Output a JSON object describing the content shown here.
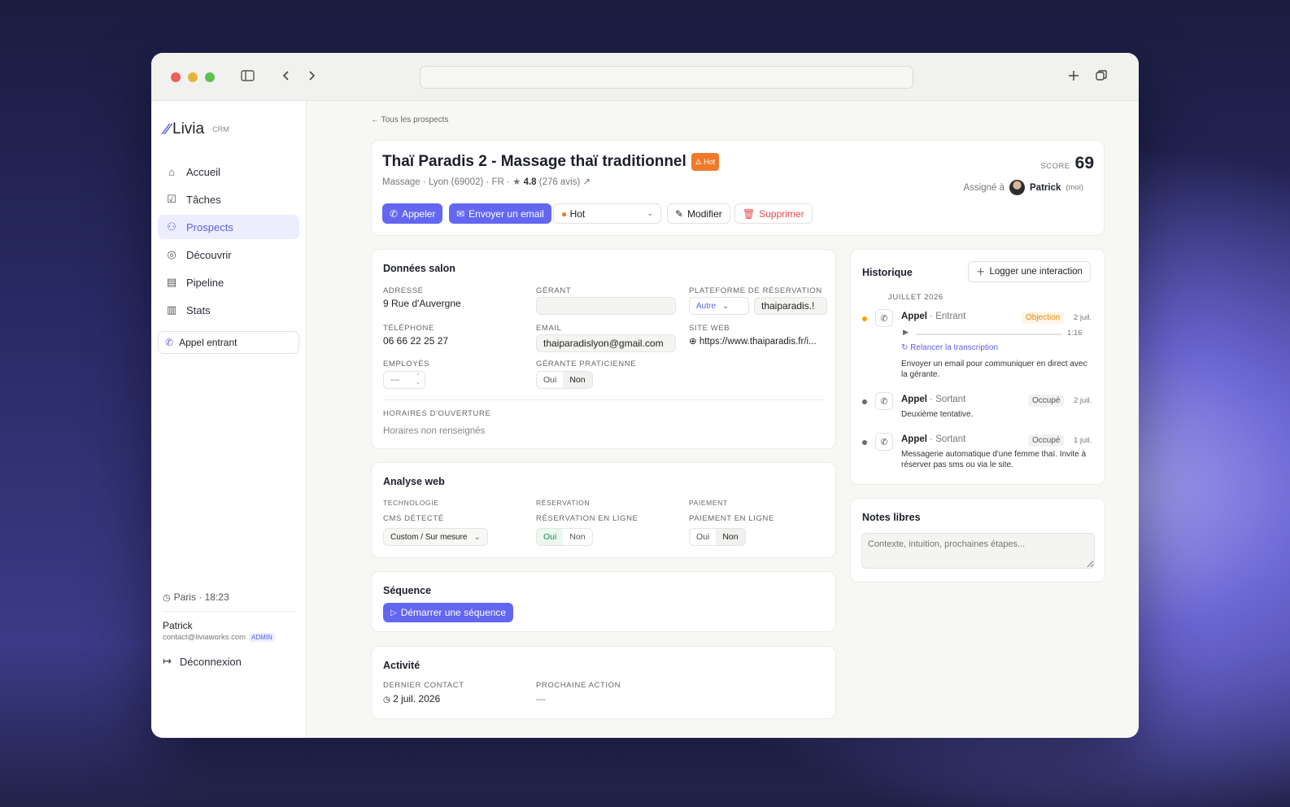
{
  "browser": {
    "url": ""
  },
  "sidebar": {
    "logo": "Livia",
    "logo_tag": "CRM",
    "items": [
      {
        "label": "Accueil",
        "icon": "home-icon"
      },
      {
        "label": "Tâches",
        "icon": "checkbox-icon"
      },
      {
        "label": "Prospects",
        "icon": "users-icon"
      },
      {
        "label": "Découvrir",
        "icon": "compass-icon"
      },
      {
        "label": "Pipeline",
        "icon": "kanban-icon"
      },
      {
        "label": "Stats",
        "icon": "bar-chart-icon"
      }
    ],
    "incoming_call": "Appel entrant",
    "clock": "Paris · 18:23",
    "user_name": "Patrick",
    "user_email": "contact@liviaworks.com",
    "user_role": "ADMIN",
    "logout": "Déconnexion"
  },
  "breadcrumb": "Tous les prospects",
  "prospect": {
    "title": "Thaï Paradis 2 - Massage thaï traditionnel",
    "status_badge": "Hot",
    "category": "Massage",
    "city": "Lyon (69002)",
    "country": "FR",
    "rating": "4.8",
    "reviews": "(276 avis)",
    "score_label": "SCORE",
    "score": "69",
    "assigned_label": "Assigné à",
    "assignee": "Patrick",
    "assignee_note": "(moi)"
  },
  "actions": {
    "call": "Appeler",
    "email": "Envoyer un email",
    "status": "Hot",
    "edit": "Modifier",
    "delete": "Supprimer"
  },
  "salon": {
    "title": "Données salon",
    "address_label": "ADRESSE",
    "address": "9 Rue d'Auvergne",
    "manager_label": "GÉRANT",
    "manager": "",
    "platform_label": "PLATEFORME DE RÉSERVATION",
    "platform_select": "Autre",
    "platform_value": "thaiparadis.!",
    "phone_label": "TÉLÉPHONE",
    "phone": "06 66 22 25 27",
    "email_label": "EMAIL",
    "email": "thaiparadislyon@gmail.com",
    "website_label": "SITE WEB",
    "website": "https://www.thaiparadis.fr/i...",
    "employees_label": "EMPLOYÉS",
    "employees": "—",
    "practitioner_label": "GÉRANTE PRATICIENNE",
    "yes": "Oui",
    "no": "Non",
    "hours_label": "HORAIRES D'OUVERTURE",
    "hours": "Horaires non renseignés"
  },
  "web": {
    "title": "Analyse web",
    "tech_label": "TECHNOLOGIE",
    "cms_label": "CMS DÉTECTÉ",
    "cms": "Custom / Sur mesure",
    "resa_label": "RÉSERVATION",
    "resa_online_label": "RÉSERVATION EN LIGNE",
    "pay_label": "PAIEMENT",
    "pay_online_label": "PAIEMENT EN LIGNE",
    "yes": "Oui",
    "no": "Non"
  },
  "sequence": {
    "title": "Séquence",
    "start": "Démarrer une séquence"
  },
  "activity": {
    "title": "Activité",
    "last_label": "DERNIER CONTACT",
    "last": "2 juil. 2026",
    "next_label": "PROCHAINE ACTION",
    "next": "—"
  },
  "history": {
    "title": "Historique",
    "log_button": "Logger une interaction",
    "month": "JUILLET 2026",
    "items": [
      {
        "type": "Appel",
        "direction": "Entrant",
        "tag": "Objection",
        "date": "2 juil.",
        "duration": "1:16",
        "retry": "Relancer la transcription",
        "note": "Envoyer un email pour communiquer en direct avec la gérante.",
        "dot": "#f59e0b"
      },
      {
        "type": "Appel",
        "direction": "Sortant",
        "tag": "Occupé",
        "date": "2 juil.",
        "note": "Deuxième tentative.",
        "dot": "#6b6b6b"
      },
      {
        "type": "Appel",
        "direction": "Sortant",
        "tag": "Occupé",
        "date": "1 juil.",
        "note": "Messagerie automatique d'une femme thaï. Invite à réserver pas sms ou via le site.",
        "dot": "#6b6b6b"
      }
    ]
  },
  "notes": {
    "title": "Notes libres",
    "placeholder": "Contexte, intuition, prochaines étapes..."
  },
  "colors": {
    "accent": "#6366f1",
    "hot": "#f07a2a",
    "danger": "#e5484d"
  }
}
